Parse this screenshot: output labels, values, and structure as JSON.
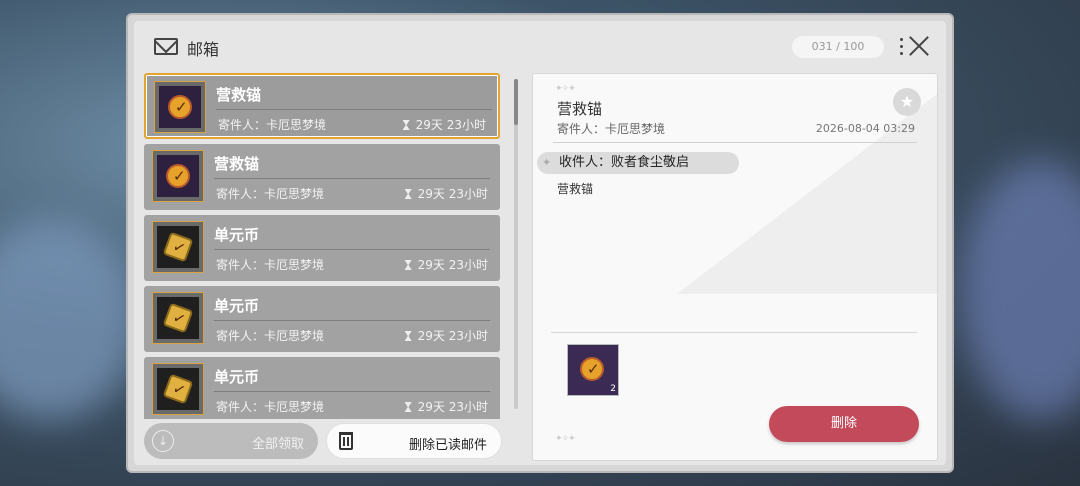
{
  "header": {
    "title": "邮箱",
    "count": "031 / 100"
  },
  "mails": [
    {
      "name": "营救锚",
      "sender": "寄件人：卡厄思梦境",
      "time": "29天 23小时",
      "icon": "anchor-icon",
      "selected": true
    },
    {
      "name": "营救锚",
      "sender": "寄件人：卡厄思梦境",
      "time": "29天 23小时",
      "icon": "anchor-icon",
      "selected": false
    },
    {
      "name": "单元币",
      "sender": "寄件人：卡厄思梦境",
      "time": "29天 23小时",
      "icon": "coin-icon",
      "selected": false
    },
    {
      "name": "单元币",
      "sender": "寄件人：卡厄思梦境",
      "time": "29天 23小时",
      "icon": "coin-icon",
      "selected": false
    },
    {
      "name": "单元币",
      "sender": "寄件人：卡厄思梦境",
      "time": "29天 23小时",
      "icon": "coin-icon",
      "selected": false
    }
  ],
  "footer": {
    "claim_all": "全部领取",
    "delete_read": "删除已读邮件"
  },
  "detail": {
    "title": "营救锚",
    "sender": "寄件人：卡厄思梦境",
    "date": "2026-08-04 03:29",
    "recipient": "收件人：败者食尘敬启",
    "body": "营救锚",
    "attachment_qty": "2",
    "delete_label": "删除"
  },
  "colors": {
    "selected_border": "#e1a534",
    "delete_button": "#c24a5a"
  }
}
